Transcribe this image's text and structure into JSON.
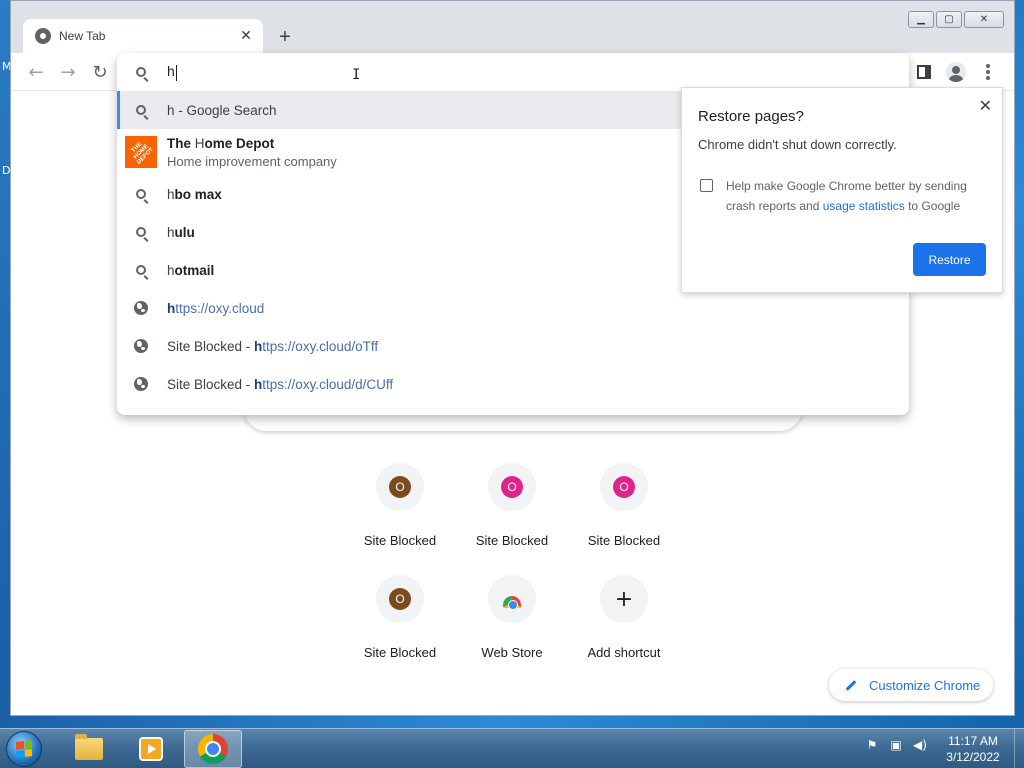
{
  "desktop": {
    "glyph_top": "M",
    "glyph_mid": "D"
  },
  "window": {
    "minimize": "▁",
    "maximize": "▢",
    "close": "✕"
  },
  "tab": {
    "title": "New Tab",
    "close": "✕",
    "new_tab": "+"
  },
  "toolbar": {
    "back": "←",
    "forward": "→",
    "reload": "↻"
  },
  "omnibox": {
    "typed": "h",
    "suggestions": [
      {
        "kind": "search",
        "text": "h - Google Search"
      },
      {
        "kind": "entity",
        "prefix": "The ",
        "match": "H",
        "rest": "ome Depot",
        "sub": "Home improvement company",
        "logo": "THE HOME DEPOT"
      },
      {
        "kind": "search",
        "prefix": "h",
        "rest": "bo max"
      },
      {
        "kind": "search",
        "prefix": "h",
        "rest": "ulu"
      },
      {
        "kind": "search",
        "prefix": "h",
        "rest": "otmail"
      },
      {
        "kind": "url",
        "label": "",
        "bold": "h",
        "rest": "ttps://oxy.cloud"
      },
      {
        "kind": "url",
        "label": "Site Blocked - ",
        "bold": "h",
        "rest": "ttps://oxy.cloud/oTff"
      },
      {
        "kind": "url",
        "label": "Site Blocked - ",
        "bold": "h",
        "rest": "ttps://oxy.cloud/d/CUff"
      }
    ]
  },
  "restore": {
    "title": "Restore pages?",
    "message": "Chrome didn't shut down correctly.",
    "checkbox_text_1": "Help make Google Chrome better by sending crash reports and ",
    "checkbox_link": "usage statistics",
    "checkbox_text_2": " to Google",
    "button": "Restore",
    "close": "✕"
  },
  "shortcuts": [
    {
      "label": "Site Blocked",
      "letter": "O",
      "color": "#7b4a1e"
    },
    {
      "label": "Site Blocked",
      "letter": "O",
      "color": "#e0248a"
    },
    {
      "label": "Site Blocked",
      "letter": "O",
      "color": "#e0248a"
    },
    {
      "label": "Site Blocked",
      "letter": "O",
      "color": "#7b4a1e"
    },
    {
      "label": "Web Store",
      "icon": "webstore-icon"
    },
    {
      "label": "Add shortcut",
      "icon": "plus-icon",
      "glyph": "+"
    }
  ],
  "customize": {
    "label": "Customize Chrome"
  },
  "taskbar": {
    "time": "11:17 AM",
    "date": "3/12/2022",
    "tray_icons": [
      "flag-icon",
      "network-icon",
      "volume-icon"
    ]
  }
}
